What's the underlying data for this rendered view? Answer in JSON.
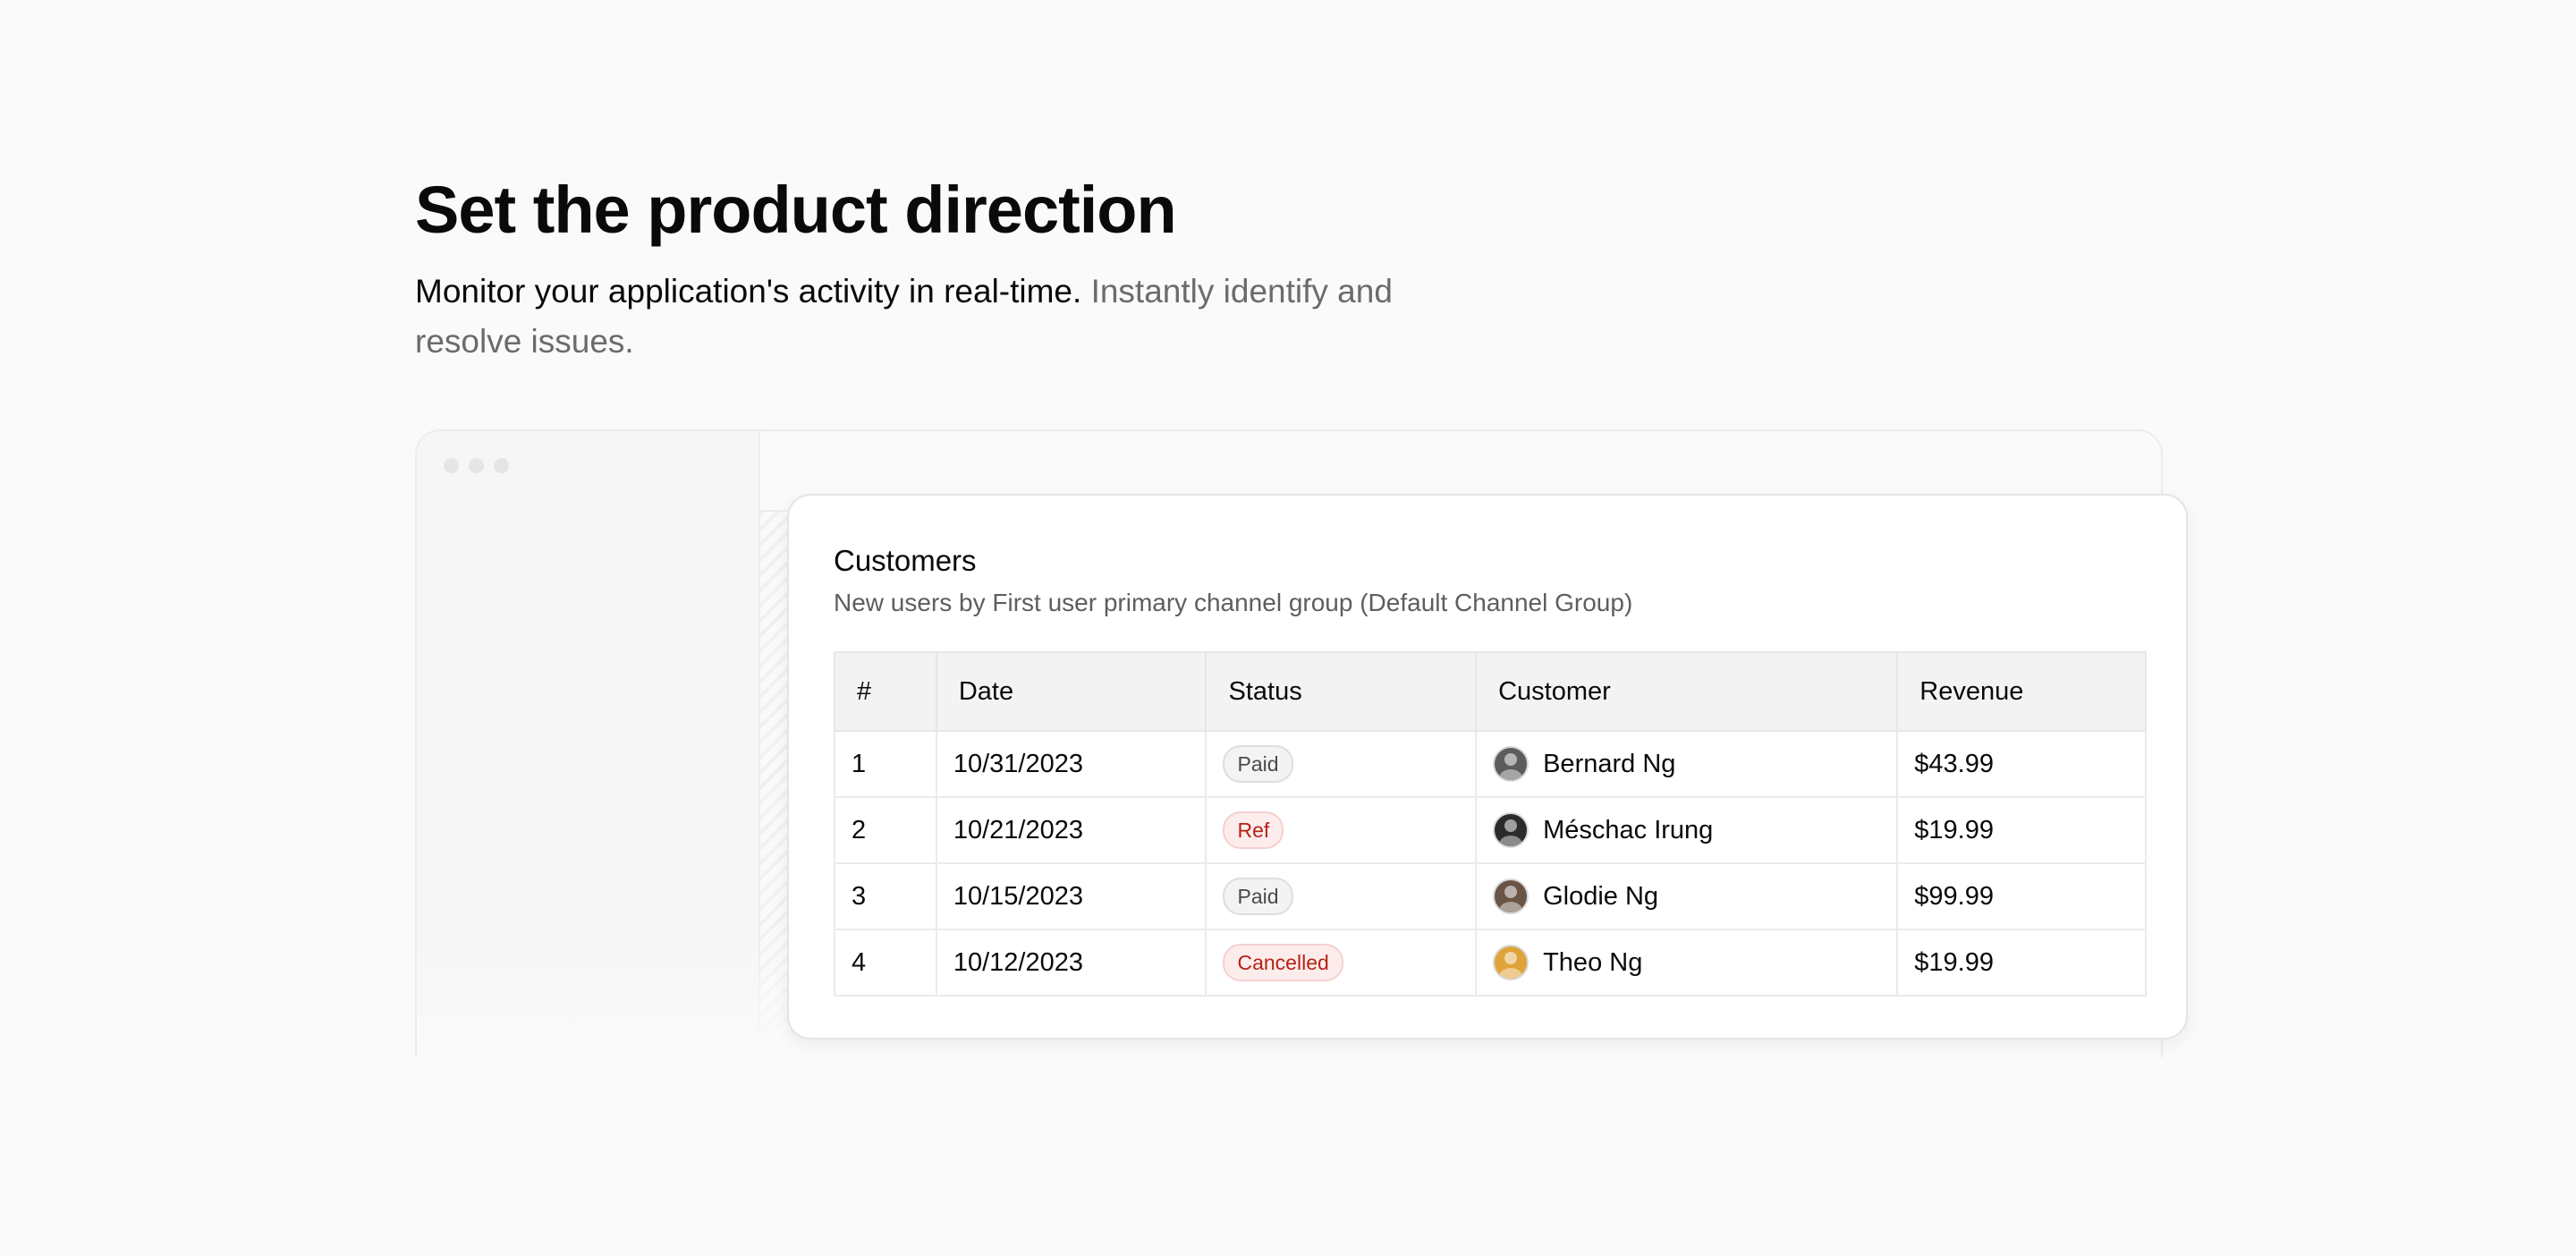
{
  "hero": {
    "title": "Set the product direction",
    "lead": "Monitor your application's activity in real-time.",
    "muted": "Instantly identify and resolve issues."
  },
  "card": {
    "title": "Customers",
    "subtitle": "New users by First user primary channel group (Default Channel Group)"
  },
  "table": {
    "columns": [
      "#",
      "Date",
      "Status",
      "Customer",
      "Revenue"
    ],
    "rows": [
      {
        "num": "1",
        "date": "10/31/2023",
        "status": "Paid",
        "customer": "Bernard Ng",
        "revenue": "$43.99"
      },
      {
        "num": "2",
        "date": "10/21/2023",
        "status": "Ref",
        "customer": "Méschac Irung",
        "revenue": "$19.99"
      },
      {
        "num": "3",
        "date": "10/15/2023",
        "status": "Paid",
        "customer": "Glodie Ng",
        "revenue": "$99.99"
      },
      {
        "num": "4",
        "date": "10/12/2023",
        "status": "Cancelled",
        "customer": "Theo Ng",
        "revenue": "$19.99"
      }
    ]
  },
  "colors": {
    "badge_neutral_text": "#4a4a4a",
    "badge_danger_text": "#b42318",
    "avatar_1": "#5c5c5c",
    "avatar_2": "#2b2b2b",
    "avatar_3": "#6a5446",
    "avatar_4": "#e0a33a"
  },
  "icons": {
    "window_controls": "traffic-light-dots",
    "avatar": "user-avatar"
  }
}
